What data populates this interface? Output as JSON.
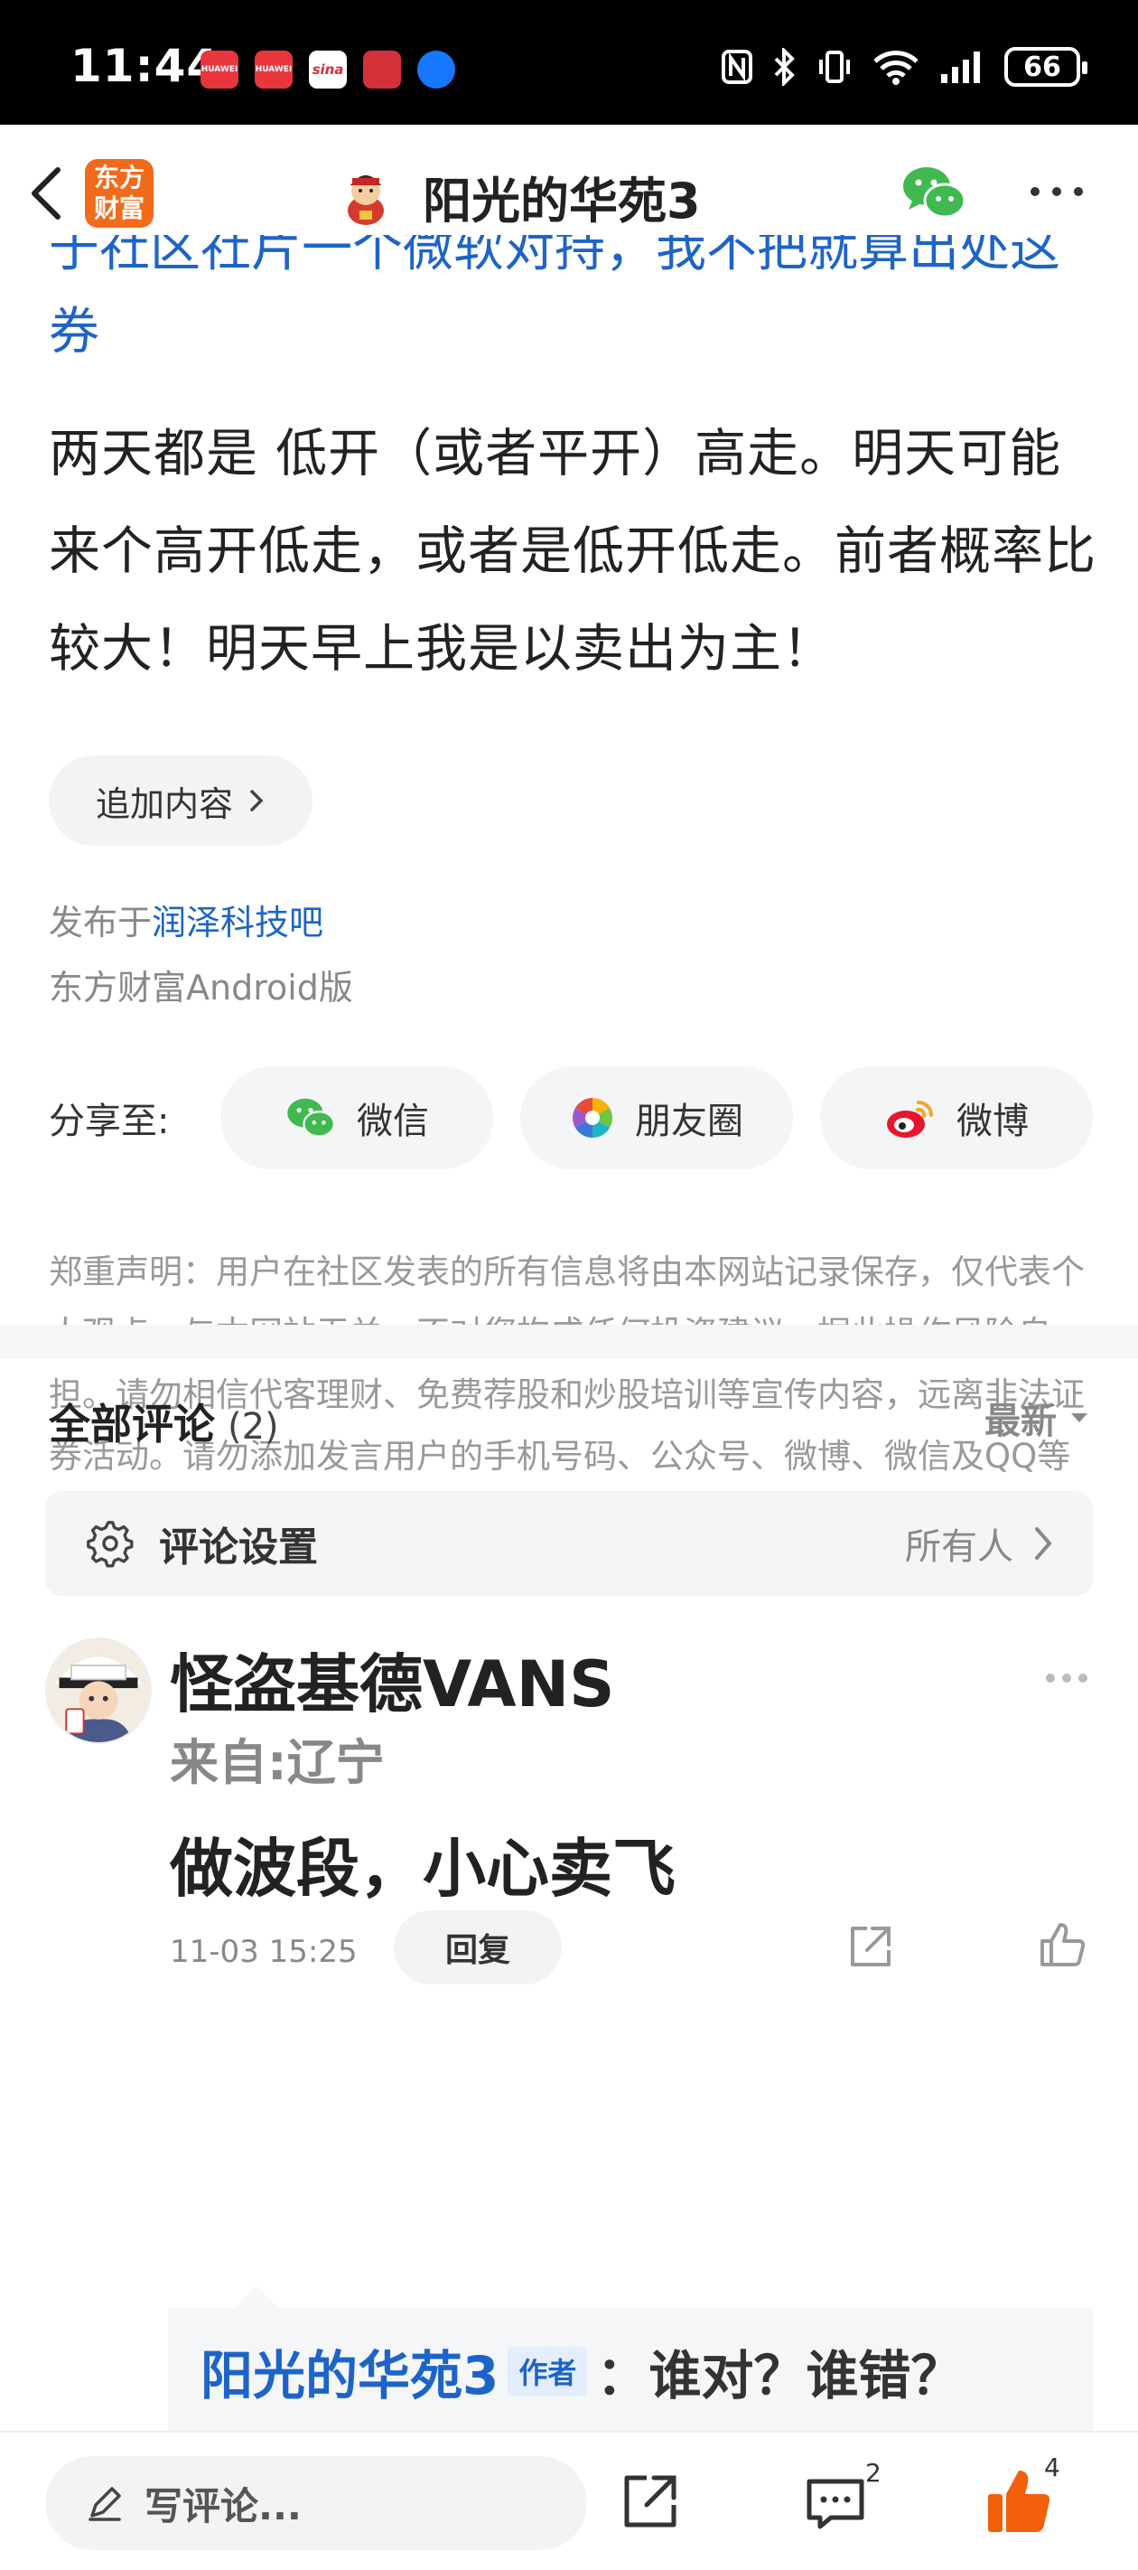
{
  "status_bar": {
    "time": "11:44",
    "apps": [
      {
        "name": "huawei-app-1",
        "label": "HUAWEI",
        "color": "#e8363c"
      },
      {
        "name": "huawei-app-2",
        "label": "HUAWEI",
        "color": "#e8363c"
      },
      {
        "name": "sina-app",
        "label": "sina",
        "color": "#ffffff"
      },
      {
        "name": "gift-app",
        "label": "",
        "color": "#d3303a"
      },
      {
        "name": "browser-app",
        "label": "",
        "color": "#1677ff"
      }
    ],
    "battery": "66"
  },
  "header": {
    "app_logo_text": "东方财富",
    "title": "阳光的华苑3"
  },
  "post": {
    "cut_line_text": "于社区社片一个微软对持，我不把就算出处这",
    "cut_line_tail": "券",
    "body": "两天都是 低开（或者平开）高走。明天可能来个高开低走，或者是低开低走。前者概率比较大！明天早上我是以卖出为主！",
    "append_button": "追加内容",
    "publish_prefix": "发布于",
    "publish_link": "润泽科技吧",
    "client": "东方财富Android版"
  },
  "share": {
    "label": "分享至:",
    "buttons": [
      {
        "name": "share-wechat",
        "label": "微信"
      },
      {
        "name": "share-moments",
        "label": "朋友圈"
      },
      {
        "name": "share-weibo",
        "label": "微博"
      }
    ]
  },
  "disclaimer": "郑重声明：用户在社区发表的所有信息将由本网站记录保存，仅代表个人观点，与本网站无关，不对您构成任何投资建议，据此操作风险自担。请勿相信代客理财、免费荐股和炒股培训等宣传内容，远离非法证券活动。请勿添加发言用户的手机号码、公众号、微博、微信及QQ等信息，谨防上当受骗！",
  "comments_section": {
    "title": "全部评论",
    "count": "(2)",
    "sort": "最新",
    "settings_label": "评论设置",
    "settings_value": "所有人"
  },
  "comment": {
    "author": "怪盗基德VANS",
    "from": "来自:辽宁",
    "text": "做波段，小心卖飞",
    "time": "11-03 15:25",
    "reply_button": "回复",
    "sub_reply": {
      "author": "阳光的华苑3",
      "badge": "作者",
      "text": "：谁对？谁错？"
    }
  },
  "bottom_bar": {
    "write_placeholder": "写评论...",
    "comment_count": "2",
    "like_count": "4"
  },
  "colors": {
    "accent_blue": "#1e64c8",
    "brand_orange": "#f26a1b",
    "like_orange": "#f2600c",
    "wechat_green": "#3fb950"
  }
}
